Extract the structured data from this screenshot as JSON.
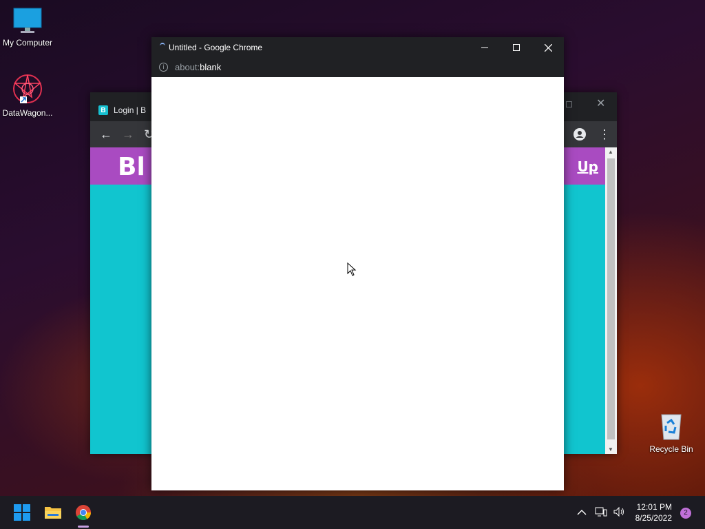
{
  "desktop": {
    "icons": [
      {
        "label": "My Computer"
      },
      {
        "label": "DataWagon..."
      },
      {
        "label": "Recycle Bin"
      }
    ]
  },
  "bg_window": {
    "tab_title": "Login | B",
    "brand": "Bl",
    "signup": "Up"
  },
  "fg_window": {
    "title": "Untitled - Google Chrome",
    "url_prefix": "about:",
    "url_main": "blank"
  },
  "taskbar": {
    "time": "12:01 PM",
    "date": "8/25/2022",
    "notifications": "2"
  },
  "colors": {
    "header_purple": "#a94bc1",
    "page_cyan": "#11c5cf",
    "taskbar": "#1c1b22"
  }
}
